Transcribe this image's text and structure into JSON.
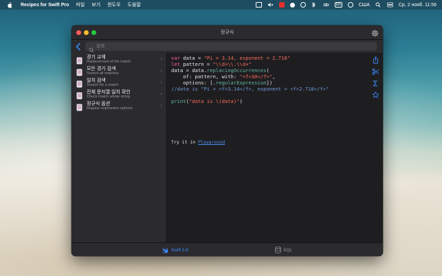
{
  "menubar": {
    "app_name": "Recipes for Swift Pro",
    "items": [
      "파일",
      "보기",
      "윈도우",
      "도움말"
    ],
    "lang": "EN",
    "country": "США",
    "datetime": "Ср, 2 нояб.  11:56"
  },
  "window": {
    "title": "정규식",
    "search_placeholder": "검색"
  },
  "sidebar": {
    "items": [
      {
        "title": "경기 교체",
        "subtitle": "Replacement of the match"
      },
      {
        "title": "모든 경기 검색",
        "subtitle": "Search all matches"
      },
      {
        "title": "일치 검색",
        "subtitle": "Search for a match"
      },
      {
        "title": "전체 문자열 일치 확인",
        "subtitle": "Check match whole string"
      },
      {
        "title": "정규식 옵션",
        "subtitle": "Regular expression options"
      }
    ]
  },
  "code": {
    "l1_kw": "var",
    "l1_a": " data = ",
    "l1_str": "\"Pi = 3.14, exponent = 2.718\"",
    "l2_kw": "let",
    "l2_a": " pattern = ",
    "l2_str": "\"\\\\d+\\\\.\\\\d+\"",
    "l3_a": "data = data.",
    "l3_fn": "replacingOccurrences",
    "l3_b": "(",
    "l4_a": "    of: pattern, with: ",
    "l4_str": "\"<f>$0</f>\"",
    "l4_b": ",",
    "l5_a": "    options: [.",
    "l5_fn": "regularExpression",
    "l5_b": "])",
    "l6_cmt": "//data is \"Pi = <f>3.14</f>, exponent = <f>2.718</f>\"",
    "l8_fn": "print",
    "l8_a": "(",
    "l8_str": "\"data is \\(data)\"",
    "l8_b": ")",
    "try_text": "Try it in ",
    "try_link": "Playground"
  },
  "tabs": {
    "swift": "Swift 5.6",
    "sql": "SQL"
  },
  "colors": {
    "accent": "#3d8bfd",
    "keyword": "#fc5fa3",
    "string": "#fc6a5d",
    "comment": "#6c98d8"
  }
}
